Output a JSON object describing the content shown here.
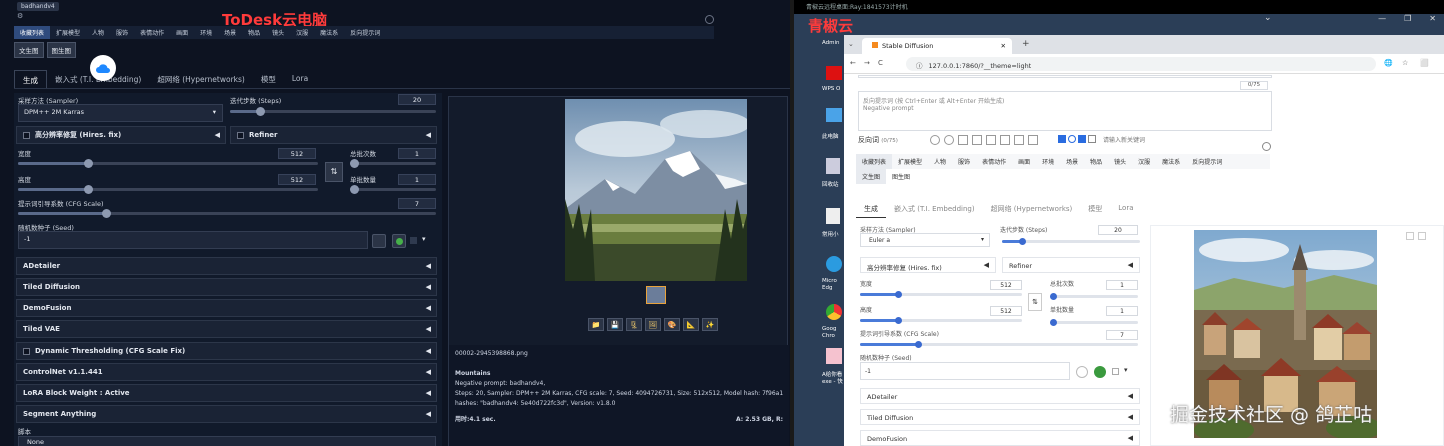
{
  "left": {
    "badge": "badhandv4",
    "gear": "⚙",
    "brand": "ToDesk云电脑",
    "tabs": [
      "收藏列表",
      "扩展模型",
      "人物",
      "服饰",
      "表情动作",
      "画面",
      "环境",
      "场景",
      "物品",
      "镜头",
      "汉服",
      "魔法系",
      "反向提示词"
    ],
    "subtabs": [
      "文生图",
      "图生图"
    ],
    "gentabs": [
      "生成",
      "嵌入式 (T.I. Embedding)",
      "超网络 (Hypernetworks)",
      "模型",
      "Lora"
    ],
    "sampler_label": "采样方法 (Sampler)",
    "sampler_value": "DPM++ 2M Karras",
    "steps_label": "迭代步数 (Steps)",
    "steps_value": "20",
    "hires_label": "高分辨率修复 (Hires. fix)",
    "refiner_label": "Refiner",
    "width_label": "宽度",
    "width_value": "512",
    "height_label": "高度",
    "height_value": "512",
    "batch_count_label": "总批次数",
    "batch_count_value": "1",
    "batch_size_label": "单批数量",
    "batch_size_value": "1",
    "cfg_label": "提示词引导系数 (CFG Scale)",
    "cfg_value": "7",
    "seed_label": "随机数种子 (Seed)",
    "seed_value": "-1",
    "swap_icon": "⇅",
    "accordions": [
      "ADetailer",
      "Tiled Diffusion",
      "DemoFusion",
      "Tiled VAE",
      "Dynamic Thresholding (CFG Scale Fix)",
      "ControlNet v1.1.441",
      "LoRA Block Weight : Active",
      "Segment Anything"
    ],
    "script_label": "脚本",
    "script_value": "None",
    "filename": "00002-2945398868.png",
    "info_title": "Mountains",
    "info_neg": "Negative prompt: badhandv4,",
    "info_params": "Steps: 20, Sampler: DPM++ 2M Karras, CFG scale: 7, Seed: 4094726731, Size: 512x512, Model hash: 7f96a1a9ca, Model: anything",
    "info_hashes": "hashes: \"badhandv4: 5e40d722fc3d\", Version: v1.8.0",
    "time": "用时:4.1 sec.",
    "vram": "A: 2.53 GB, R:",
    "arrow": "◀",
    "dropdown": "▾",
    "tool_icons": [
      "📁",
      "💾",
      "🗜",
      "🖼",
      "🎨",
      "📐",
      "✨"
    ]
  },
  "right": {
    "topbar": "青椒云远程桌面:Ray:1841573计时机",
    "brand": "青椒云",
    "chevron": "⌄",
    "window_controls": [
      "—",
      "❐",
      "✕"
    ],
    "desktop_icons": [
      "Admin",
      "WPS O",
      "此电脑",
      "回收站",
      "常用小",
      "Micro Edg",
      "Goog Chro",
      "A给你看exe - 快"
    ],
    "tab_title": "Stable Diffusion",
    "tab_close": "✕",
    "new_tab": "+",
    "tab_dropdown": "⌄",
    "nav": [
      "←",
      "→",
      "C",
      "ⓘ"
    ],
    "url": "127.0.0.1:7860/?__theme=light",
    "omnibox_icons": [
      "🌐",
      "☆",
      "⬜"
    ],
    "neg_placeholder": "反向提示词 (按 Ctrl+Enter 或 Alt+Enter 开始生成)\nNegative prompt",
    "neg_count": "0/75",
    "neg_label": "反向词",
    "neg_tokens": "(0/75)",
    "keyword_placeholder": "请输入新关键词",
    "tabs": [
      "收藏列表",
      "扩展模型",
      "人物",
      "服饰",
      "表情动作",
      "画面",
      "环境",
      "场景",
      "物品",
      "镜头",
      "汉服",
      "魔法系",
      "反向提示词"
    ],
    "subtabs": [
      "文生图",
      "图生图"
    ],
    "gentabs": [
      "生成",
      "嵌入式 (T.I. Embedding)",
      "超网络 (Hypernetworks)",
      "模型",
      "Lora"
    ],
    "sampler_label": "采样方法 (Sampler)",
    "sampler_value": "Euler a",
    "steps_label": "迭代步数 (Steps)",
    "steps_value": "20",
    "hires_label": "高分辨率修复 (Hires. fix)",
    "refiner_label": "Refiner",
    "width_label": "宽度",
    "width_value": "512",
    "height_label": "高度",
    "height_value": "512",
    "batch_count_label": "总批次数",
    "batch_count_value": "1",
    "batch_size_label": "单批数量",
    "batch_size_value": "1",
    "cfg_label": "提示词引导系数 (CFG Scale)",
    "cfg_value": "7",
    "seed_label": "随机数种子 (Seed)",
    "seed_value": "-1",
    "accordions": [
      "ADetailer",
      "Tiled Diffusion",
      "DemoFusion"
    ],
    "arrow": "◀",
    "dropdown": "▾"
  },
  "watermark": "掘金技术社区 @ 鸽芷咕"
}
